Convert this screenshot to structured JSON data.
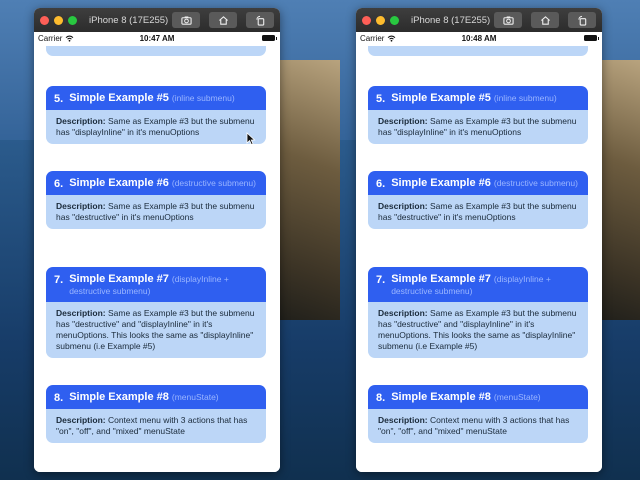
{
  "simulators": [
    {
      "window_title": "iPhone 8 (17E255)",
      "status": {
        "carrier": "Carrier",
        "time": "10:47 AM"
      }
    },
    {
      "window_title": "iPhone 8 (17E255)",
      "status": {
        "carrier": "Carrier",
        "time": "10:48 AM"
      }
    }
  ],
  "cards": [
    {
      "num": "5.",
      "title": "Simple Example #5",
      "sub": "(inline submenu)",
      "desc_label": "Description:",
      "desc": "Same as Example #3 but the submenu has \"displayInline\" in it's menuOptions"
    },
    {
      "num": "6.",
      "title": "Simple Example #6",
      "sub": "(destructive submenu)",
      "desc_label": "Description:",
      "desc": "Same as Example #3 but the submenu has \"destructive\" in it's menuOptions"
    },
    {
      "num": "7.",
      "title": "Simple Example #7",
      "sub": "(displayInline + destructive submenu)",
      "desc_label": "Description:",
      "desc": "Same as Example #3 but the submenu has \"destructive\" and \"displayInline\" in it's menuOptions. This looks the same as \"displayInline\" submenu (i.e Example #5)"
    },
    {
      "num": "8.",
      "title": "Simple Example #8",
      "sub": "(menuState)",
      "desc_label": "Description:",
      "desc": "Context menu with 3 actions that has \"on\", \"off\", and \"mixed\" menuState"
    }
  ],
  "icons": {
    "traffic_lights": [
      "close-light",
      "minimize-light",
      "zoom-light"
    ],
    "toolbar": [
      "screenshot-icon",
      "home-icon",
      "rotate-icon"
    ]
  },
  "colors": {
    "card_header": "#2f5ff0",
    "card_body": "#bcd6f7",
    "card_subtitle": "#9ab5ff"
  }
}
